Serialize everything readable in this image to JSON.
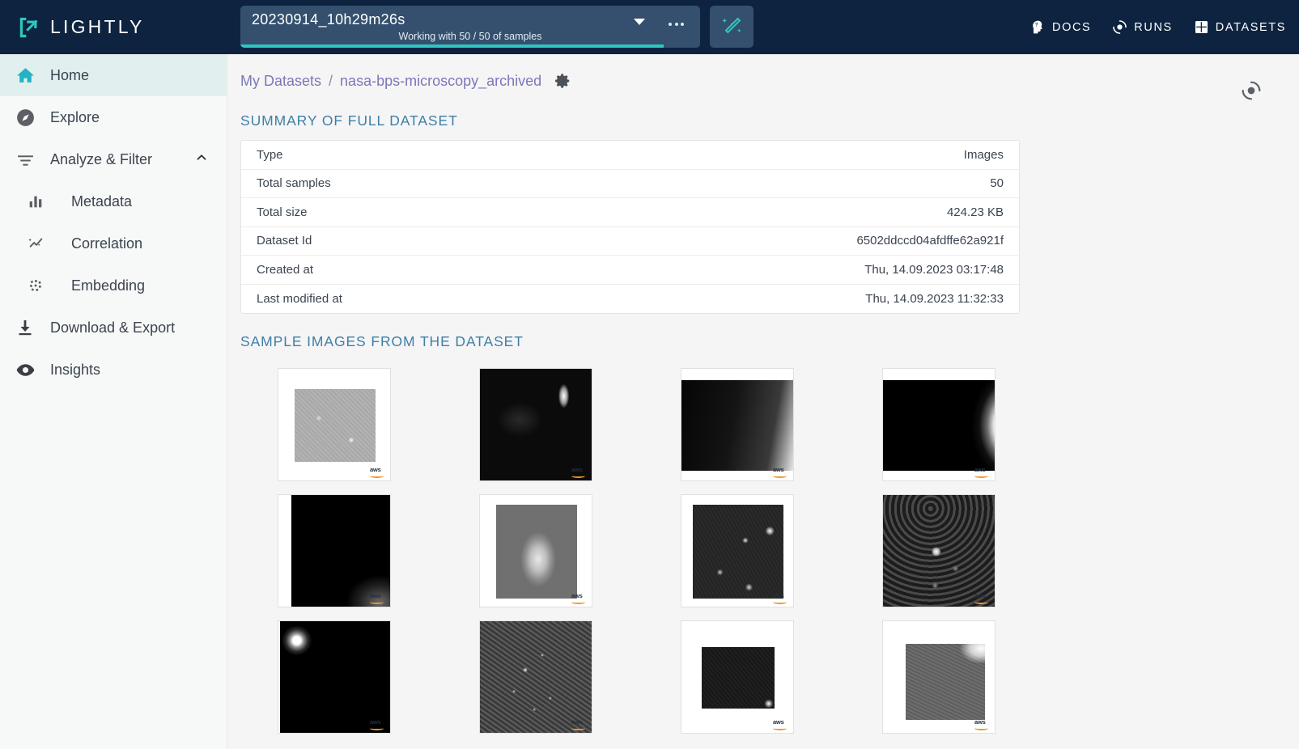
{
  "app": {
    "brand": "LIGHTLY",
    "colors": {
      "topbar_bg": "#0d2340",
      "accent_teal": "#2fc6c0",
      "select_bg": "#34506e",
      "sidebar_bg": "#f7f8f8",
      "active_item_bg": "#e1f0ef",
      "content_bg": "#f5f5f6",
      "link_purple": "#7b77b9",
      "section_blue": "#3f7fa6",
      "aws_orange": "#f0962a"
    }
  },
  "dataset_selector": {
    "name": "20230914_10h29m26s",
    "subtitle": "Working with 50 / 50 of samples",
    "caret_icon": "chevron-down-icon",
    "more_icon": "more-horizontal-icon",
    "progress_percent": 92
  },
  "magic_button": {
    "icon": "magic-wand-icon"
  },
  "topnav": [
    {
      "label": "DOCS",
      "icon": "head-question-icon"
    },
    {
      "label": "RUNS",
      "icon": "target-circle-icon"
    },
    {
      "label": "DATASETS",
      "icon": "grid-squares-icon"
    }
  ],
  "sidebar": {
    "items": [
      {
        "label": "Home",
        "icon": "home-icon",
        "active": true,
        "sub": false
      },
      {
        "label": "Explore",
        "icon": "compass-icon",
        "active": false,
        "sub": false
      },
      {
        "label": "Analyze & Filter",
        "icon": "filter-icon",
        "active": false,
        "sub": false,
        "expanded": true,
        "chevron": "chevron-up-icon"
      },
      {
        "label": "Metadata",
        "icon": "bar-chart-icon",
        "active": false,
        "sub": true
      },
      {
        "label": "Correlation",
        "icon": "sparkle-trend-icon",
        "active": false,
        "sub": true
      },
      {
        "label": "Embedding",
        "icon": "scatter-dots-icon",
        "active": false,
        "sub": true
      },
      {
        "label": "Download & Export",
        "icon": "download-icon",
        "active": false,
        "sub": false
      },
      {
        "label": "Insights",
        "icon": "eye-icon",
        "active": false,
        "sub": false
      }
    ]
  },
  "breadcrumb": {
    "root": "My Datasets",
    "separator": "/",
    "current": "nasa-bps-microscopy_archived",
    "gear_icon": "gear-icon"
  },
  "header_right": {
    "icon": "target-circle-icon"
  },
  "summary": {
    "title": "SUMMARY OF FULL DATASET",
    "rows": [
      {
        "key": "Type",
        "value": "Images"
      },
      {
        "key": "Total samples",
        "value": "50"
      },
      {
        "key": "Total size",
        "value": "424.23 KB"
      },
      {
        "key": "Dataset Id",
        "value": "6502ddccd04afdffe62a921f"
      },
      {
        "key": "Created at",
        "value": "Thu, 14.09.2023 03:17:48"
      },
      {
        "key": "Last modified at",
        "value": "Thu, 14.09.2023 11:32:33"
      }
    ]
  },
  "gallery": {
    "title": "SAMPLE IMAGES FROM THE DATASET",
    "badge_text": "aws",
    "items": [
      {
        "id": "sample-1",
        "alt": "grayscale microscopy speckle, light gray, letterboxed"
      },
      {
        "id": "sample-2",
        "alt": "dark field with bright elongated cell upper right"
      },
      {
        "id": "sample-3",
        "alt": "dark gradient with bright edge on right"
      },
      {
        "id": "sample-4",
        "alt": "black field with bright curved boundary right"
      },
      {
        "id": "sample-5",
        "alt": "black field with soft glow lower right"
      },
      {
        "id": "sample-6",
        "alt": "gray noisy field with bright central blob"
      },
      {
        "id": "sample-7",
        "alt": "dark field with several bright specks"
      },
      {
        "id": "sample-8",
        "alt": "dark field with bright central point and rings"
      },
      {
        "id": "sample-9",
        "alt": "black field with bright halo top left"
      },
      {
        "id": "sample-10",
        "alt": "dense bright speckle cluster on dark field"
      },
      {
        "id": "sample-11",
        "alt": "very dark field with small bright spot bottom right"
      },
      {
        "id": "sample-12",
        "alt": "gray noisy field with bright top right corner"
      }
    ]
  }
}
